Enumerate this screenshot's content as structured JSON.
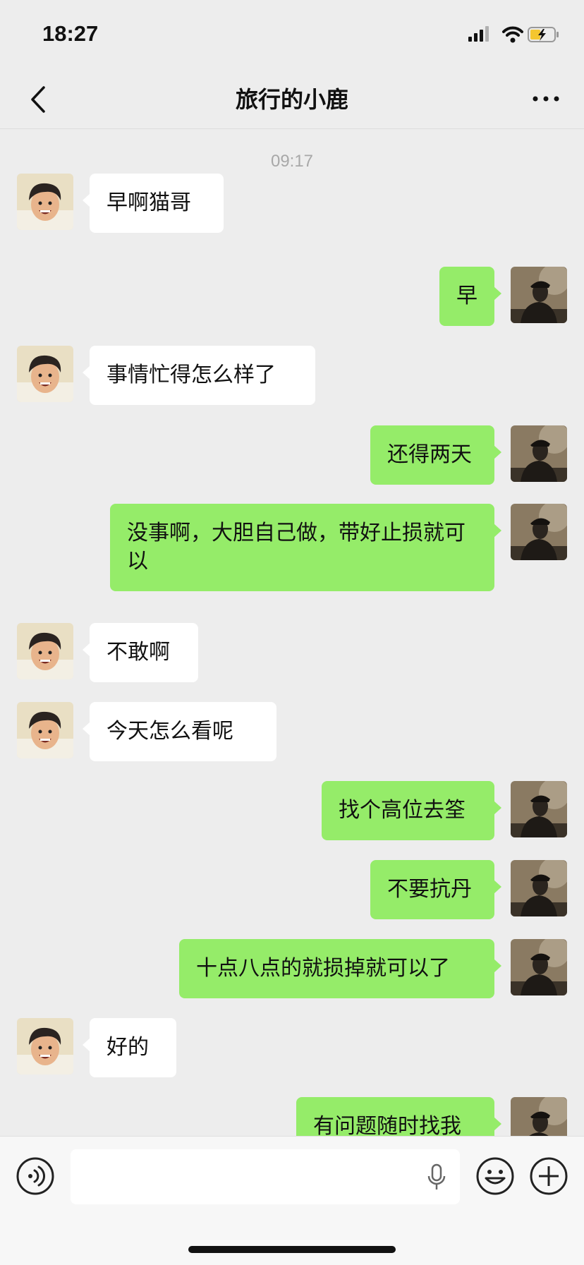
{
  "status_bar": {
    "time": "18:27"
  },
  "nav": {
    "title": "旅行的小鹿"
  },
  "chat": {
    "timestamp": "09:17",
    "messages": [
      {
        "side": "left",
        "text": "早啊猫哥"
      },
      {
        "side": "right",
        "text": "早"
      },
      {
        "side": "left",
        "text": "事情忙得怎么样了"
      },
      {
        "side": "right",
        "text": "还得两天"
      },
      {
        "side": "right",
        "text": "没事啊，大胆自己做，带好止损就可以"
      },
      {
        "side": "left",
        "text": "不敢啊"
      },
      {
        "side": "left",
        "text": "今天怎么看呢"
      },
      {
        "side": "right",
        "text": "找个高位去筌"
      },
      {
        "side": "right",
        "text": "不要抗丹"
      },
      {
        "side": "right",
        "text": "十点八点的就损掉就可以了"
      },
      {
        "side": "left",
        "text": "好的"
      },
      {
        "side": "right",
        "text": "有问题随时找我"
      }
    ]
  },
  "colors": {
    "background": "#ededed",
    "bubble_sent": "#95ec69",
    "bubble_received": "#ffffff"
  },
  "icons": [
    "back-icon",
    "more-icon",
    "voice-icon",
    "mic-icon",
    "emoji-icon",
    "plus-icon",
    "signal-icon",
    "wifi-icon",
    "battery-icon"
  ]
}
